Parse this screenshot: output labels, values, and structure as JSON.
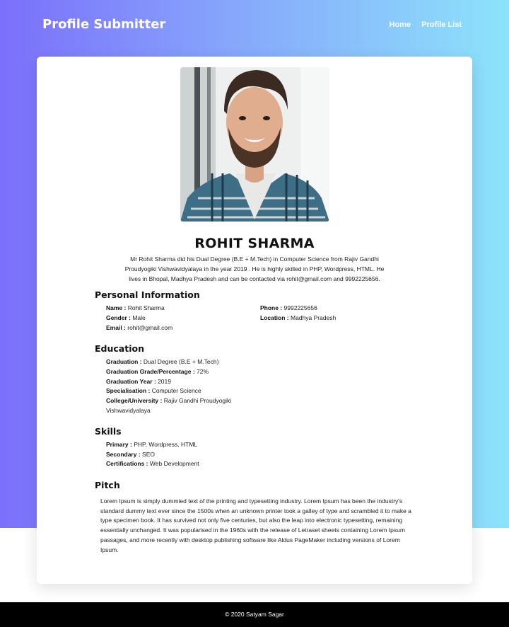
{
  "navbar": {
    "brand": "Profile Submitter",
    "links": [
      "Home",
      "Profile List"
    ]
  },
  "profile": {
    "name": "ROHIT SHARMA",
    "summary": "Mr Rohit Sharma did his Dual Degree (B.E + M.Tech) in Computer Science from Rajiv Gandhi Proudyogiki Vishwavidyalaya in the year 2019 . He is highly skilled in PHP, Wordpress, HTML. He lives in Bhopal, Madhya Pradesh and can be contacted via rohit@gmail.com and 9992225656."
  },
  "personal": {
    "title": "Personal Information",
    "name_label": "Name :",
    "name_value": "Rohit Sharma",
    "gender_label": "Gender :",
    "gender_value": "Male",
    "email_label": "Email :",
    "email_value": "rohit@gmail.com",
    "phone_label": "Phone :",
    "phone_value": "9992225656",
    "location_label": "Location :",
    "location_value": "Madhya Pradesh"
  },
  "education": {
    "title": "Education",
    "graduation_label": "Graduation :",
    "graduation_value": "Dual Degree (B.E + M.Tech)",
    "grade_label": "Graduation Grade/Percentage :",
    "grade_value": "72%",
    "year_label": "Graduation Year :",
    "year_value": "2019",
    "spec_label": "Specialisation :",
    "spec_value": "Computer Science",
    "college_label": "College/University :",
    "college_value": "Rajiv Gandhi Proudyogiki",
    "college_value_2": "Vishwavidyalaya"
  },
  "skills": {
    "title": "Skills",
    "primary_label": "Primary :",
    "primary_value": "PHP, Wordpress, HTML",
    "secondary_label": "Secondary :",
    "secondary_value": "SEO",
    "cert_label": "Certifications :",
    "cert_value": "Web Development"
  },
  "pitch": {
    "title": "Pitch",
    "text": "Lorem Ipsum is simply dummied text of the printing and typesetting industry. Lorem Ipsum has been the industry's standard dummy text ever since the 1500s when an unknown printer took a galley of type and scrambled it to make a type specimen book. It has survived not only five centuries, but also the leap into electronic typesetting, remaining essentially unchanged. It was popularised in the 1960s with the release of Letraset sheets containing Lorem Ipsum passages, and more recently with desktop publishing software like Aldus PageMaker including versions of Lorem Ipsum."
  },
  "footer": {
    "text": "© 2020 Satyam Sagar"
  }
}
